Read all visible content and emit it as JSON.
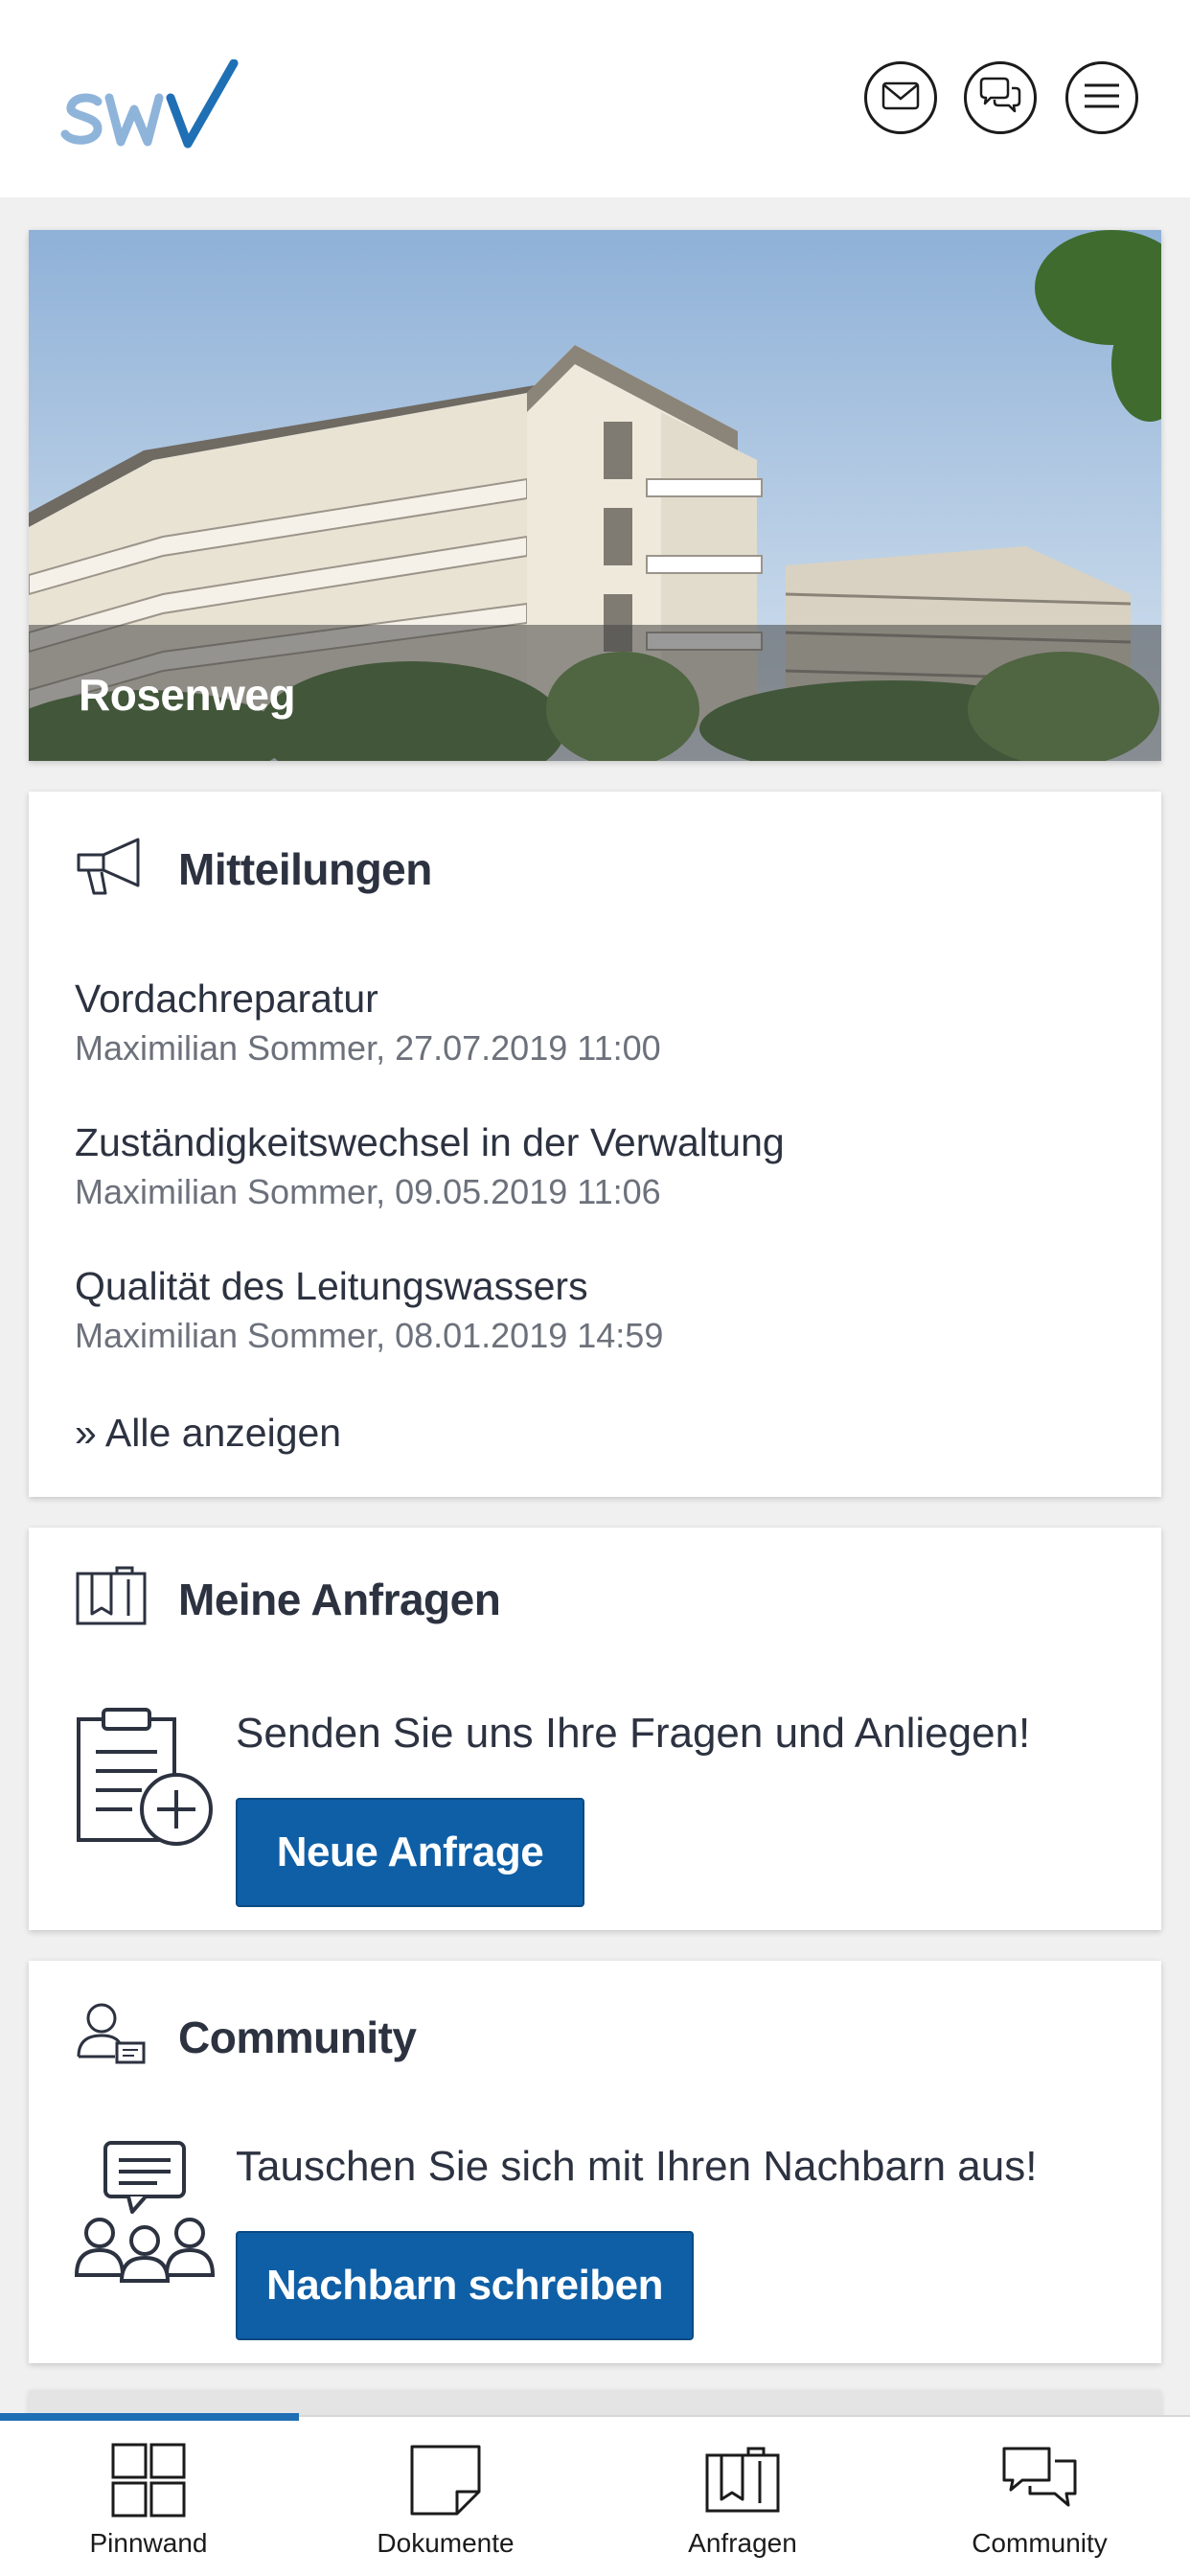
{
  "header": {
    "logo_text": "swv",
    "icons": [
      "mail-icon",
      "chat-icon",
      "menu-icon"
    ]
  },
  "hero": {
    "title": "Rosenweg"
  },
  "mitteilungen": {
    "title": "Mitteilungen",
    "items": [
      {
        "title": "Vordachreparatur",
        "meta": "Maximilian Sommer, 27.07.2019 11:00"
      },
      {
        "title": "Zuständigkeitswechsel in der Verwaltung",
        "meta": "Maximilian Sommer, 09.05.2019 11:06"
      },
      {
        "title": "Qualität des Leitungswassers",
        "meta": "Maximilian Sommer, 08.01.2019 14:59"
      }
    ],
    "all_link": "» Alle anzeigen"
  },
  "anfragen": {
    "title": "Meine Anfragen",
    "text": "Senden Sie uns Ihre Fragen und Anliegen!",
    "button": "Neue Anfrage"
  },
  "community": {
    "title": "Community",
    "text": "Tauschen Sie sich mit Ihren Nachbarn aus!",
    "button": "Nachbarn schreiben"
  },
  "nav": {
    "items": [
      {
        "label": "Pinnwand",
        "icon": "grid-icon",
        "active": true
      },
      {
        "label": "Dokumente",
        "icon": "document-icon",
        "active": false
      },
      {
        "label": "Anfragen",
        "icon": "folder-icon",
        "active": false
      },
      {
        "label": "Community",
        "icon": "chat-bubbles-icon",
        "active": false
      }
    ]
  },
  "colors": {
    "brand_blue": "#0f5fa6",
    "logo_light_blue": "#8fb4da",
    "text_dark": "#2c3240",
    "text_muted": "#6c717b"
  }
}
